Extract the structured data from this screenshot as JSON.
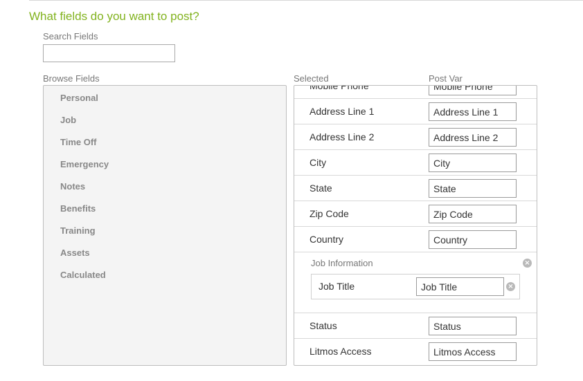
{
  "heading": "What fields do you want to post?",
  "search": {
    "label": "Search Fields",
    "value": "",
    "placeholder": ""
  },
  "browse": {
    "label": "Browse Fields",
    "items": [
      "Personal",
      "Job",
      "Time Off",
      "Emergency",
      "Notes",
      "Benefits",
      "Training",
      "Assets",
      "Calculated"
    ]
  },
  "selected": {
    "label": "Selected",
    "post_var_label": "Post Var",
    "rows": [
      {
        "label": "Mobile Phone",
        "value": "Mobile Phone"
      },
      {
        "label": "Address Line 1",
        "value": "Address Line 1"
      },
      {
        "label": "Address Line 2",
        "value": "Address Line 2"
      },
      {
        "label": "City",
        "value": "City"
      },
      {
        "label": "State",
        "value": "State"
      },
      {
        "label": "Zip Code",
        "value": "Zip Code"
      },
      {
        "label": "Country",
        "value": "Country"
      }
    ],
    "group": {
      "title": "Job Information",
      "row": {
        "label": "Job Title",
        "value": "Job Title"
      }
    },
    "rows_after": [
      {
        "label": "Status",
        "value": "Status"
      },
      {
        "label": "Litmos Access",
        "value": "Litmos Access"
      }
    ]
  },
  "icons": {
    "remove": "close-circle-icon"
  },
  "colors": {
    "heading": "#82b31f",
    "browse_bg": "#f4f4f4",
    "border": "#bdbdbd"
  }
}
